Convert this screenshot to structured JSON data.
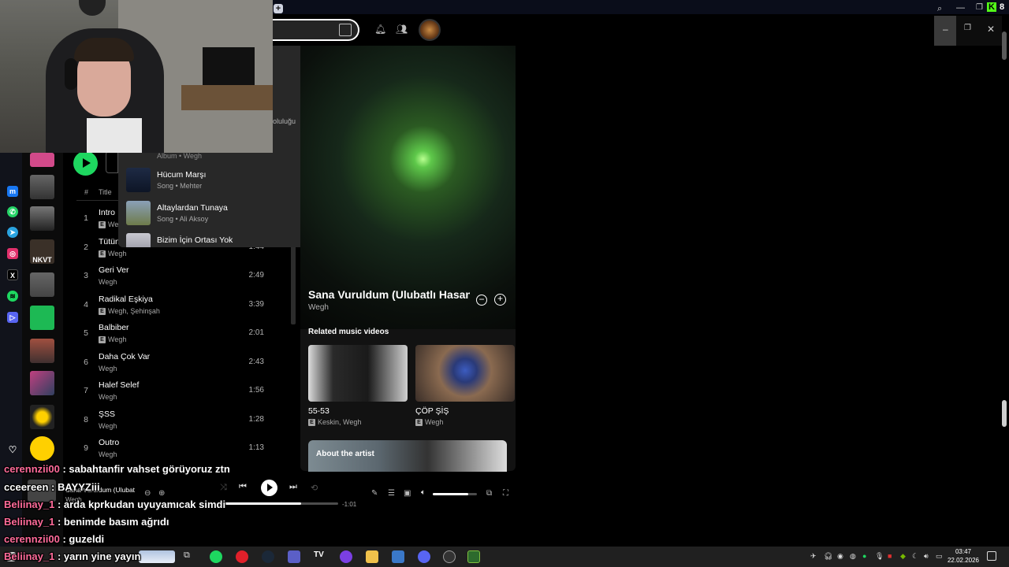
{
  "browser": {
    "new_tab": "+"
  },
  "system": {
    "kick_count": "8"
  },
  "dropdown": {
    "partial_text": "oluluğu",
    "item0_sub": "Album • Wegh",
    "items": [
      {
        "title": "Hücum Marşı",
        "sub": "Song • Mehter"
      },
      {
        "title": "Altaylardan Tunaya",
        "sub": "Song • Ali Aksoy"
      },
      {
        "title": "Bizim İçin Ortası Yok",
        "sub": ""
      }
    ]
  },
  "tracklist": {
    "header_num": "#",
    "header_title": "Title",
    "explicit": "E",
    "rows": [
      {
        "num": "1",
        "title": "Intro",
        "artist": "We",
        "duration": ""
      },
      {
        "num": "2",
        "title": "Tütün",
        "artist": "Wegh",
        "duration": "1:44"
      },
      {
        "num": "3",
        "title": "Geri Ver",
        "artist": "Wegh",
        "duration": "2:49"
      },
      {
        "num": "4",
        "title": "Radikal Eşkiya",
        "artist": "Wegh, Şehinşah",
        "duration": "3:39"
      },
      {
        "num": "5",
        "title": "Balbiber",
        "artist": "Wegh",
        "duration": "2:01"
      },
      {
        "num": "6",
        "title": "Daha Çok Var",
        "artist": "Wegh",
        "duration": "2:43"
      },
      {
        "num": "7",
        "title": "Halef Selef",
        "artist": "Wegh",
        "duration": "1:56"
      },
      {
        "num": "8",
        "title": "ŞSS",
        "artist": "Wegh",
        "duration": "1:28"
      },
      {
        "num": "9",
        "title": "Outro",
        "artist": "Wegh",
        "duration": "1:13"
      }
    ]
  },
  "now_playing": {
    "title": "Sana Vuruldum (Ulubatlı Hasan)",
    "artist": "Wegh",
    "related_heading": "Related music videos",
    "related": [
      {
        "title": "55-53",
        "artist": "Keskin, Wegh"
      },
      {
        "title": "ÇÖP ŞİŞ",
        "artist": "Wegh"
      }
    ],
    "about_label": "About the artist"
  },
  "player": {
    "song": "Sana Vuruldum (Ulubat",
    "artist": "Wegh",
    "remaining": "-1:01",
    "progress": 0.68,
    "volume": 0.8
  },
  "chat": [
    {
      "user": "cerennzii00",
      "msg": ": sabahtanfir vahset görüyoruz ztn"
    },
    {
      "user": "cceereen",
      "msg": ": BAYYZiii"
    },
    {
      "user": "Beliinay_1",
      "msg": ": arda kprkudan uyuyamıcak simdi"
    },
    {
      "user": "Beliinay_1",
      "msg": ": benimde basım ağrıdı"
    },
    {
      "user": "cerennzii00",
      "msg": ": guzeldi"
    },
    {
      "user": "Beliinay_1",
      "msg": ": yarın yine yayın"
    }
  ],
  "taskbar": {
    "time": "03:47",
    "date": "22.02.2026"
  }
}
